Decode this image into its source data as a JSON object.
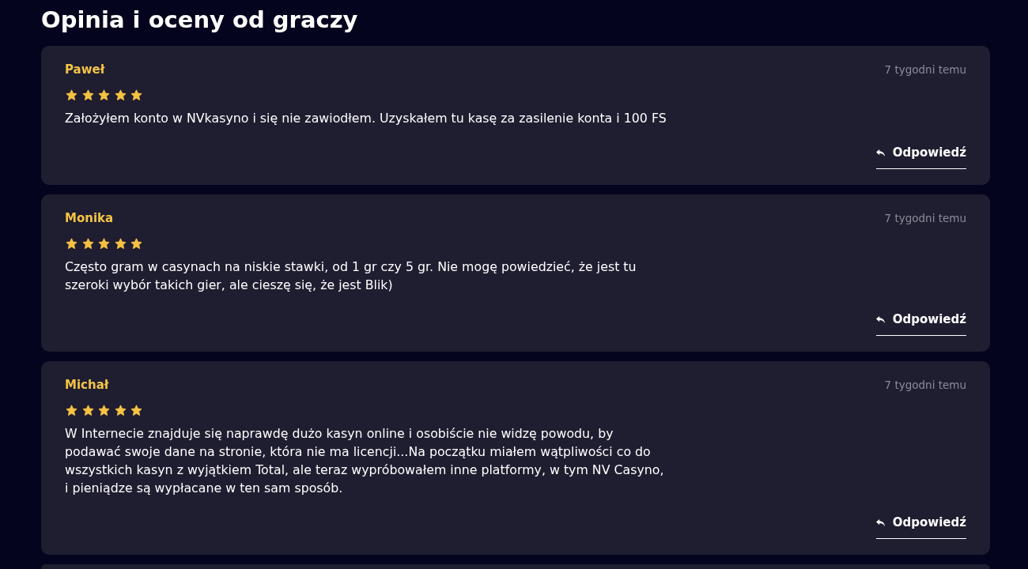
{
  "title": "Opinia i oceny od graczy",
  "reviews": [
    {
      "author": "Paweł",
      "time": "7 tygodni temu",
      "stars": 5,
      "text": "Założyłem konto w NVkasyno i się nie zawiodłem. Uzyskałem tu kasę za zasilenie konta i 100 FS",
      "reply_label": "Odpowiedź"
    },
    {
      "author": "Monika",
      "time": "7 tygodni temu",
      "stars": 5,
      "text": "Często gram w casynach na niskie stawki, od 1 gr czy 5 gr. Nie mogę powiedzieć, że jest tu szeroki wybór takich gier, ale cieszę się, że jest Blik)",
      "reply_label": "Odpowiedź"
    },
    {
      "author": "Michał",
      "time": "7 tygodni temu",
      "stars": 5,
      "text": "W Internecie znajduje się naprawdę dużo kasyn online i osobiście nie widzę powodu, by podawać swoje dane na stronie, która nie ma licencji...Na początku miałem wątpliwości co do wszystkich kasyn z wyjątkiem Total, ale teraz wypróbowałem inne platformy, w tym NV Casyno, i pieniądze są wypłacane w ten sam sposób.",
      "reply_label": "Odpowiedź"
    }
  ]
}
